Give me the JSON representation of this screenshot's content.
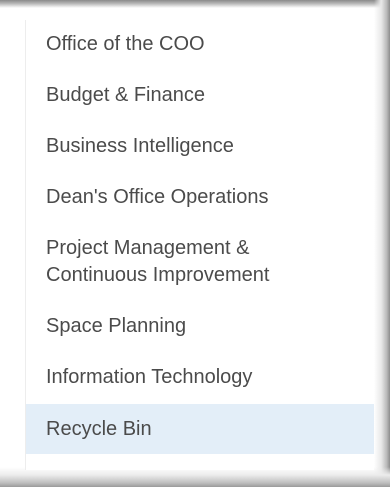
{
  "nav": {
    "items": [
      {
        "label": "Office of the COO",
        "selected": false
      },
      {
        "label": "Budget & Finance",
        "selected": false
      },
      {
        "label": "Business Intelligence",
        "selected": false
      },
      {
        "label": "Dean's Office Operations",
        "selected": false
      },
      {
        "label_line1": "Project Management &",
        "label_line2": "Continuous Improvement",
        "selected": false
      },
      {
        "label": "Space Planning",
        "selected": false
      },
      {
        "label": "Information Technology",
        "selected": false
      },
      {
        "label": "Recycle Bin",
        "selected": true
      }
    ]
  },
  "colors": {
    "text": "#4b4b4b",
    "selected_background": "#e3eef8",
    "panel_background": "#ffffff"
  }
}
